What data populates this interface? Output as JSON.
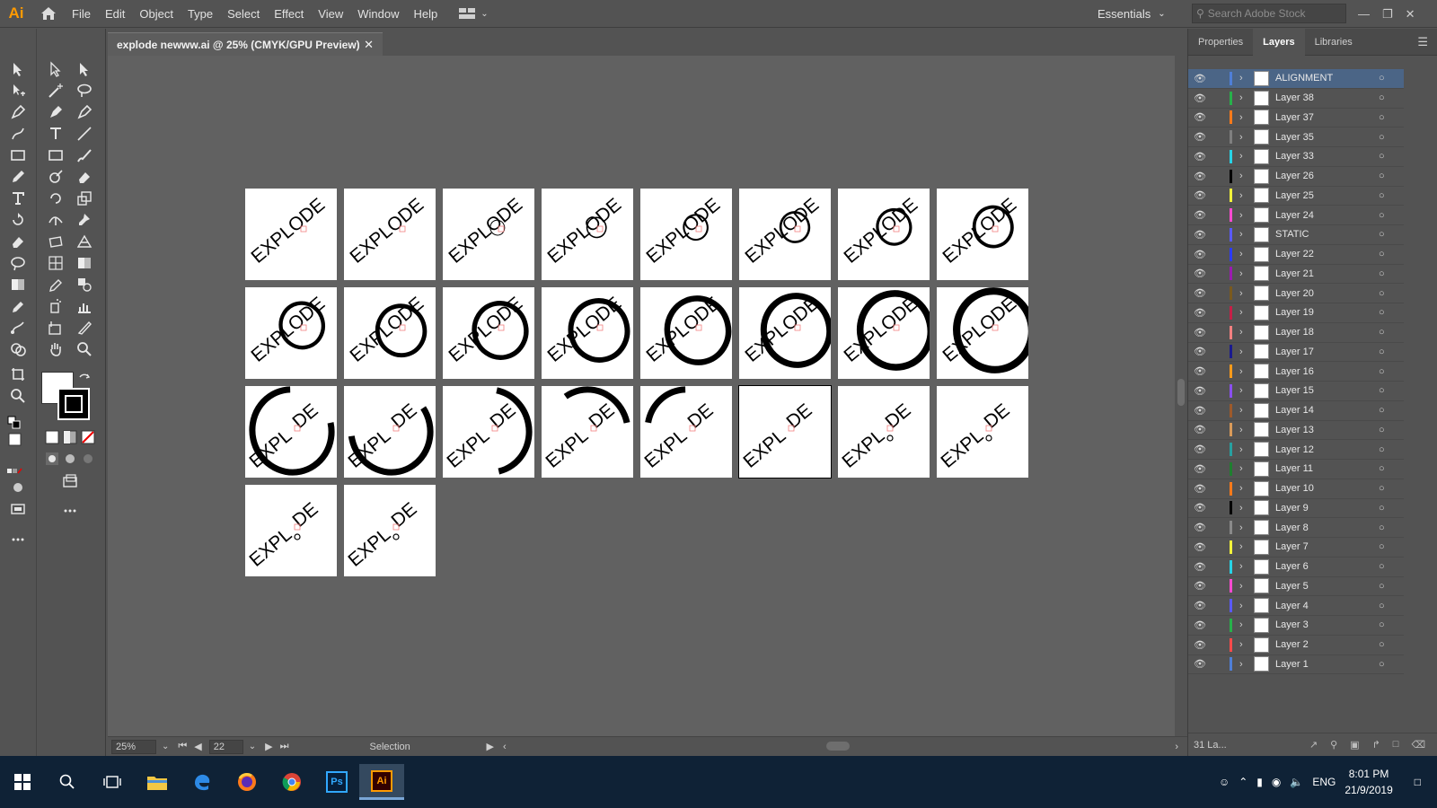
{
  "app": {
    "logo": "Ai",
    "menu": [
      "File",
      "Edit",
      "Object",
      "Type",
      "Select",
      "Effect",
      "View",
      "Window",
      "Help"
    ],
    "workspace": "Essentials",
    "search_placeholder": "Search Adobe Stock"
  },
  "document": {
    "tab_title": "explode newww.ai @ 25% (CMYK/GPU Preview)",
    "zoom": "25%",
    "artboard_number": "22",
    "status_tool": "Selection"
  },
  "artboard_text": "EXPLODE",
  "panel": {
    "tabs": [
      "Properties",
      "Layers",
      "Libraries"
    ],
    "active_tab": "Layers",
    "layer_count_label": "31 La...",
    "layers": [
      {
        "name": "ALIGNMENT",
        "color": "#4f7fd8"
      },
      {
        "name": "Layer 38",
        "color": "#27b14a"
      },
      {
        "name": "Layer 37",
        "color": "#ff7a1a"
      },
      {
        "name": "Layer 35",
        "color": "#7f7f7f"
      },
      {
        "name": "Layer 33",
        "color": "#27d3e6"
      },
      {
        "name": "Layer 26",
        "color": "#000000"
      },
      {
        "name": "Layer 25",
        "color": "#f2f23a"
      },
      {
        "name": "Layer 24",
        "color": "#ff4ad1"
      },
      {
        "name": "STATIC",
        "color": "#5a5aff"
      },
      {
        "name": "Layer 22",
        "color": "#2b3bff"
      },
      {
        "name": "Layer 21",
        "color": "#9b1bb0"
      },
      {
        "name": "Layer 20",
        "color": "#7a5a1e"
      },
      {
        "name": "Layer 19",
        "color": "#c61f47"
      },
      {
        "name": "Layer 18",
        "color": "#f28080"
      },
      {
        "name": "Layer 17",
        "color": "#1a1a8f"
      },
      {
        "name": "Layer 16",
        "color": "#ff9a1a"
      },
      {
        "name": "Layer 15",
        "color": "#8a4ef0"
      },
      {
        "name": "Layer 14",
        "color": "#9e5a2a"
      },
      {
        "name": "Layer 13",
        "color": "#d99a5a"
      },
      {
        "name": "Layer 12",
        "color": "#27a0a0"
      },
      {
        "name": "Layer 11",
        "color": "#1f7f2f"
      },
      {
        "name": "Layer 10",
        "color": "#ff7a1a"
      },
      {
        "name": "Layer 9",
        "color": "#000000"
      },
      {
        "name": "Layer 8",
        "color": "#8a8a8a"
      },
      {
        "name": "Layer 7",
        "color": "#f2f23a"
      },
      {
        "name": "Layer 6",
        "color": "#27d3e6"
      },
      {
        "name": "Layer 5",
        "color": "#ff4ad1"
      },
      {
        "name": "Layer 4",
        "color": "#5a5aff"
      },
      {
        "name": "Layer 3",
        "color": "#27b14a"
      },
      {
        "name": "Layer 2",
        "color": "#ff4a4a"
      },
      {
        "name": "Layer 1",
        "color": "#4f7fd8"
      }
    ]
  },
  "taskbar": {
    "language": "ENG",
    "time": "8:01 PM",
    "date": "21/9/2019",
    "apps": [
      "Ps",
      "Ai"
    ]
  }
}
